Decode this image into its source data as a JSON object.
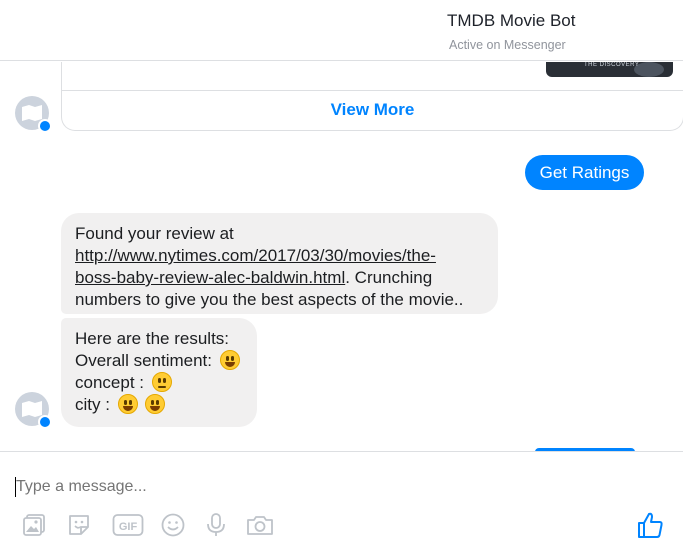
{
  "header": {
    "title": "TMDB Movie Bot",
    "status": "Active on Messenger"
  },
  "card": {
    "thumbnail_text": "THE DISCOVERY",
    "view_more_label": "View More"
  },
  "quick_reply": {
    "label": "Get Ratings"
  },
  "messages": {
    "m1": {
      "prefix": "Found your review at",
      "link": "http://www.nytimes.com/2017/03/30/movies/the-boss-baby-review-alec-baldwin.html",
      "link_line1": "http://www.nytimes.com/2017/03/30/movies/the-",
      "link_line2": "boss-baby-review-alec-baldwin.html",
      "after_link": ". Crunching",
      "line4": "numbers to give you the best aspects of the movie.."
    },
    "m2": {
      "line1": "Here are the results:",
      "overall": "Overall sentiment:",
      "concept": "concept :",
      "city": "city :",
      "emoji_overall": "grinning",
      "emoji_concept": "neutral",
      "emoji_city": [
        "grinning",
        "grinning"
      ]
    }
  },
  "composer": {
    "placeholder": "Type a message..."
  },
  "icons": [
    "image-icon",
    "sticker-icon",
    "gif-icon",
    "emoji-icon",
    "microphone-icon",
    "camera-icon",
    "thumbs-up-icon"
  ],
  "colors": {
    "accent": "#0084ff",
    "bubble": "#f1f0f0",
    "muted": "#90949c"
  }
}
